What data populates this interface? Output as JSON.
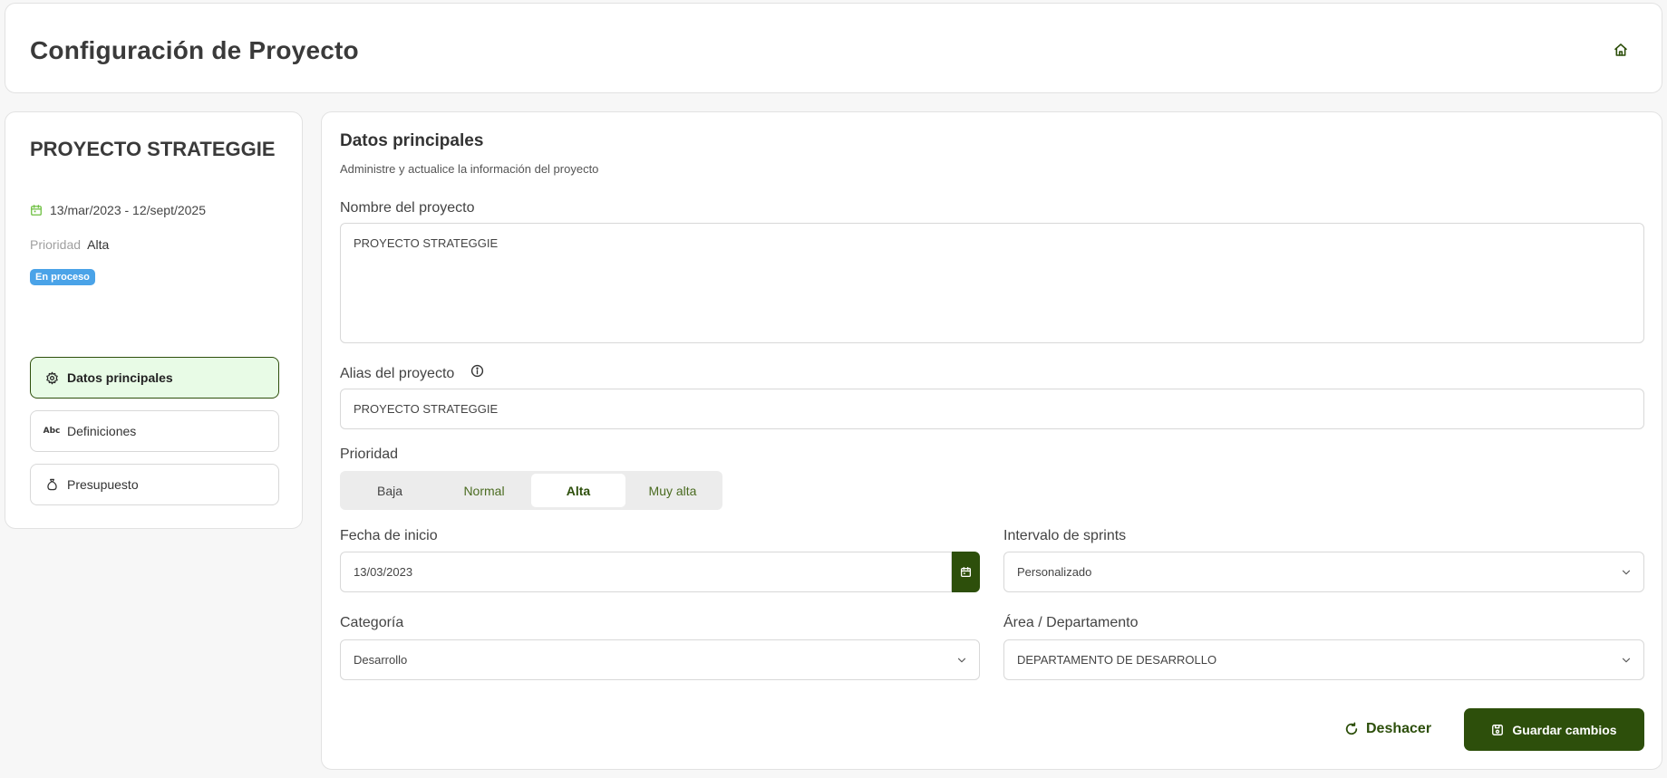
{
  "header": {
    "title": "Configuración de Proyecto",
    "home_icon": "home-icon"
  },
  "sidebar": {
    "project_name": "PROYECTO STRATEGGIE",
    "date_range": "13/mar/2023 - 12/sept/2025",
    "priority_label": "Prioridad",
    "priority_value": "Alta",
    "status": "En proceso",
    "status_color": "#4aa3e8",
    "nav": [
      {
        "label": "Datos principales",
        "icon": "gear-icon",
        "active": true
      },
      {
        "label": "Definiciones",
        "icon": "abc-icon",
        "active": false
      },
      {
        "label": "Presupuesto",
        "icon": "money-bag-icon",
        "active": false
      }
    ]
  },
  "main": {
    "title": "Datos principales",
    "subtitle": "Administre y actualice la información del proyecto",
    "name_label": "Nombre del proyecto",
    "name_value": "PROYECTO STRATEGGIE",
    "alias_label": "Alias del proyecto",
    "alias_value": "PROYECTO STRATEGGIE",
    "priority_label": "Prioridad",
    "priority_options": [
      "Baja",
      "Normal",
      "Alta",
      "Muy alta"
    ],
    "priority_selected": "Alta",
    "start_date_label": "Fecha de inicio",
    "start_date_value": "13/03/2023",
    "sprint_label": "Intervalo de sprints",
    "sprint_value": "Personalizado",
    "category_label": "Categoría",
    "category_value": "Desarrollo",
    "area_label": "Área / Departamento",
    "area_value": "DEPARTAMENTO DE DESARROLLO",
    "undo_label": "Deshacer",
    "save_label": "Guardar cambios"
  },
  "colors": {
    "accent": "#2d4f0b",
    "active_nav_bg": "#e8fbe6",
    "badge": "#4aa3e8"
  }
}
